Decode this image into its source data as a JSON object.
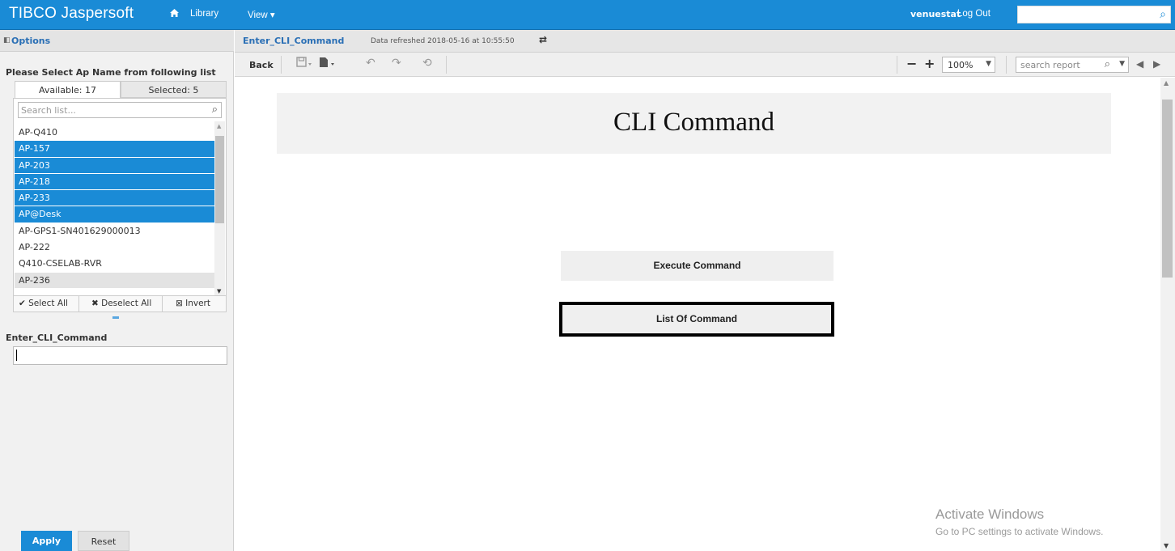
{
  "topbar": {
    "brand": "TIBCO Jaspersoft",
    "library": "Library",
    "view": "View ▾",
    "username": "venuestat",
    "logout": "Log Out",
    "home_icon": "home-icon",
    "search_icon": "search-icon"
  },
  "left": {
    "options_title": "Options",
    "prompt": "Please Select Ap Name from following list",
    "tab_available": "Available: 17",
    "tab_selected": "Selected: 5",
    "search_placeholder": "Search list...",
    "items": [
      {
        "label": "AP-Q410",
        "selected": false
      },
      {
        "label": "AP-157",
        "selected": true
      },
      {
        "label": "AP-203",
        "selected": true
      },
      {
        "label": "AP-218",
        "selected": true
      },
      {
        "label": "AP-233",
        "selected": true
      },
      {
        "label": "AP@Desk",
        "selected": true
      },
      {
        "label": "AP-GPS1-SN401629000013",
        "selected": false
      },
      {
        "label": "AP-222",
        "selected": false
      },
      {
        "label": "Q410-CSELAB-RVR",
        "selected": false
      },
      {
        "label": "AP-236",
        "selected": false,
        "hover": true
      }
    ],
    "select_all": "✔ Select All",
    "deselect_all": "✖ Deselect All",
    "invert": "⊠ Invert",
    "cmd_label": "Enter_CLI_Command",
    "cmd_value": "",
    "apply": "Apply",
    "reset": "Reset"
  },
  "report": {
    "name": "Enter_CLI_Command",
    "refreshed": "Data refreshed 2018-05-16 at 10:55:50",
    "back": "Back",
    "zoom": "100%",
    "search_placeholder": "search report",
    "title": "CLI Command",
    "execute_button": "Execute Command",
    "list_button": "List Of Command"
  },
  "watermark": {
    "line1": "Activate Windows",
    "line2": "Go to PC settings to activate Windows."
  },
  "colors": {
    "accent": "#1a8bd6",
    "panel": "#f1f1f1"
  }
}
